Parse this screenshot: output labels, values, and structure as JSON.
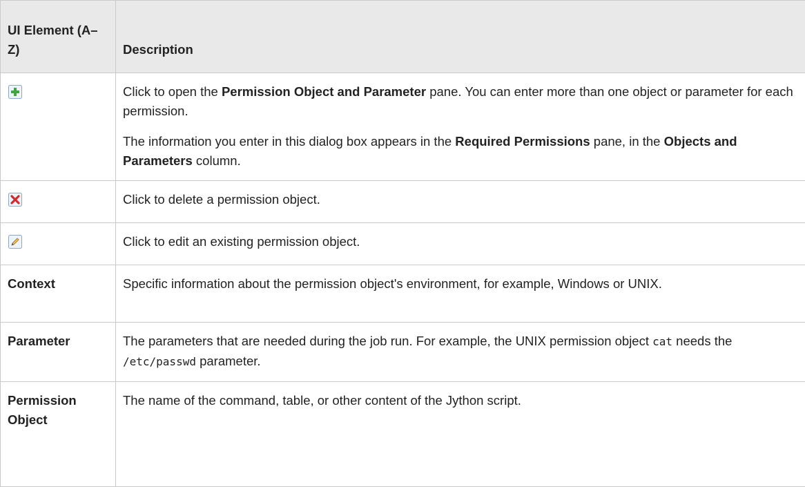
{
  "table": {
    "headers": {
      "element": "UI Element (A–Z)",
      "description": "Description"
    },
    "rows": [
      {
        "icon": "add-icon",
        "desc_para1": {
          "a": "Click to open the ",
          "b": "Permission Object and Parameter",
          "c": " pane. You can enter more than one object or parameter for each permission."
        },
        "desc_para2": {
          "a": "The information you enter in this dialog box appears in the ",
          "b": "Required Permissions",
          "c": " pane, in the ",
          "d": "Objects and Parameters",
          "e": " column."
        }
      },
      {
        "icon": "delete-icon",
        "desc": "Click to delete a permission object."
      },
      {
        "icon": "edit-pencil-icon",
        "desc": "Click to edit an existing permission object."
      },
      {
        "name": "Context",
        "desc": "Specific information about the permission object's environment, for example, Windows or UNIX."
      },
      {
        "name": "Parameter",
        "desc": {
          "a": "The parameters that are needed during the job run. For example, the UNIX permission object ",
          "code1": "cat",
          "b": " needs the ",
          "code2": "/etc/passwd",
          "c": " parameter."
        }
      },
      {
        "name": "Permission Object",
        "desc": "The name of the command, table, or other content of the Jython script."
      }
    ]
  }
}
